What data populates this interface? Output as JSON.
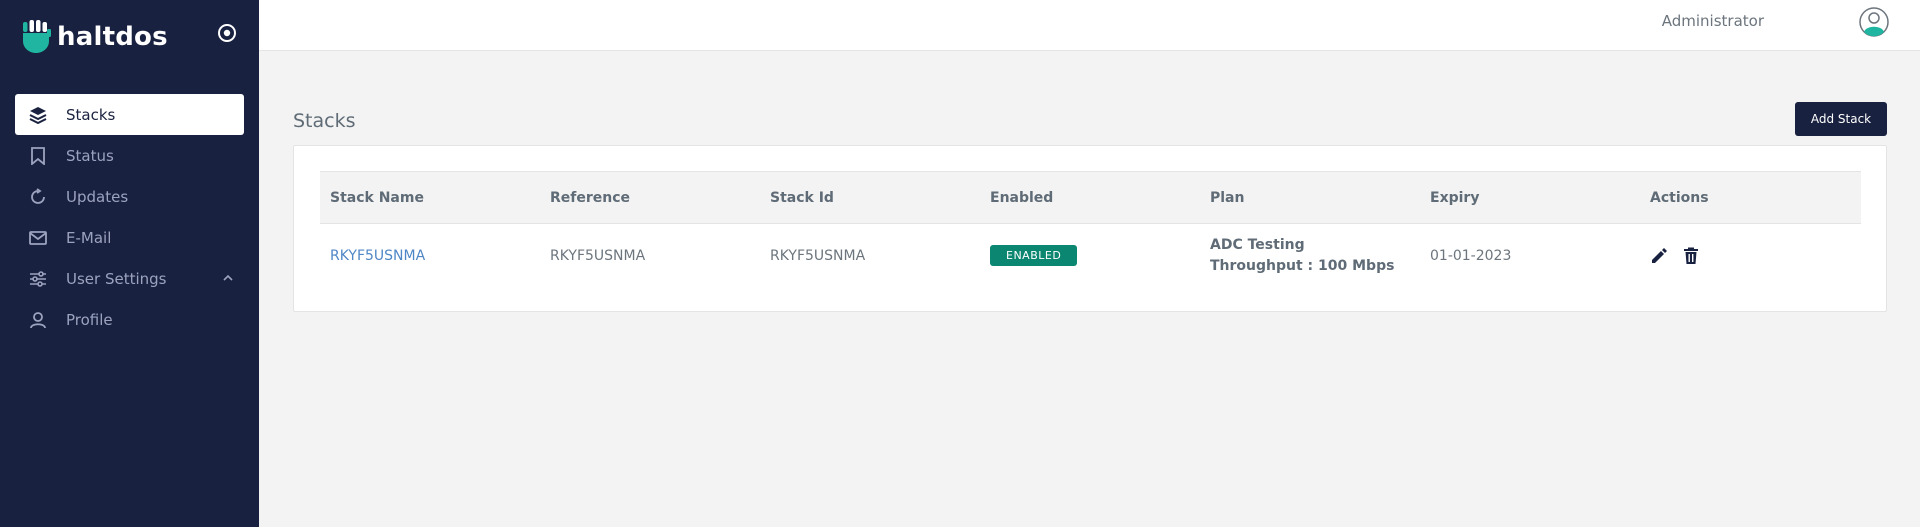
{
  "brand": {
    "name": "haltdos",
    "accent": "#1fb5a0",
    "sidebar_bg": "#192141"
  },
  "sidebar": {
    "items": [
      {
        "label": "Stacks",
        "icon": "layers-icon",
        "active": true
      },
      {
        "label": "Status",
        "icon": "bookmark-icon"
      },
      {
        "label": "Updates",
        "icon": "refresh-icon"
      },
      {
        "label": "E-Mail",
        "icon": "mail-icon"
      },
      {
        "label": "User Settings",
        "icon": "sliders-icon",
        "expandable": true
      },
      {
        "label": "Profile",
        "icon": "user-icon"
      }
    ]
  },
  "header": {
    "user_name": "Administrator"
  },
  "main": {
    "title": "Stacks",
    "add_button_label": "Add Stack",
    "table": {
      "columns": [
        "Stack Name",
        "Reference",
        "Stack Id",
        "Enabled",
        "Plan",
        "Expiry",
        "Actions"
      ],
      "rows": [
        {
          "stack_name": "RKYF5USNMA",
          "reference": "RKYF5USNMA",
          "stack_id": "RKYF5USNMA",
          "enabled": "ENABLED",
          "plan_name": "ADC Testing",
          "plan_throughput": "Throughput : 100 Mbps",
          "expiry": "01-01-2023"
        }
      ]
    }
  }
}
